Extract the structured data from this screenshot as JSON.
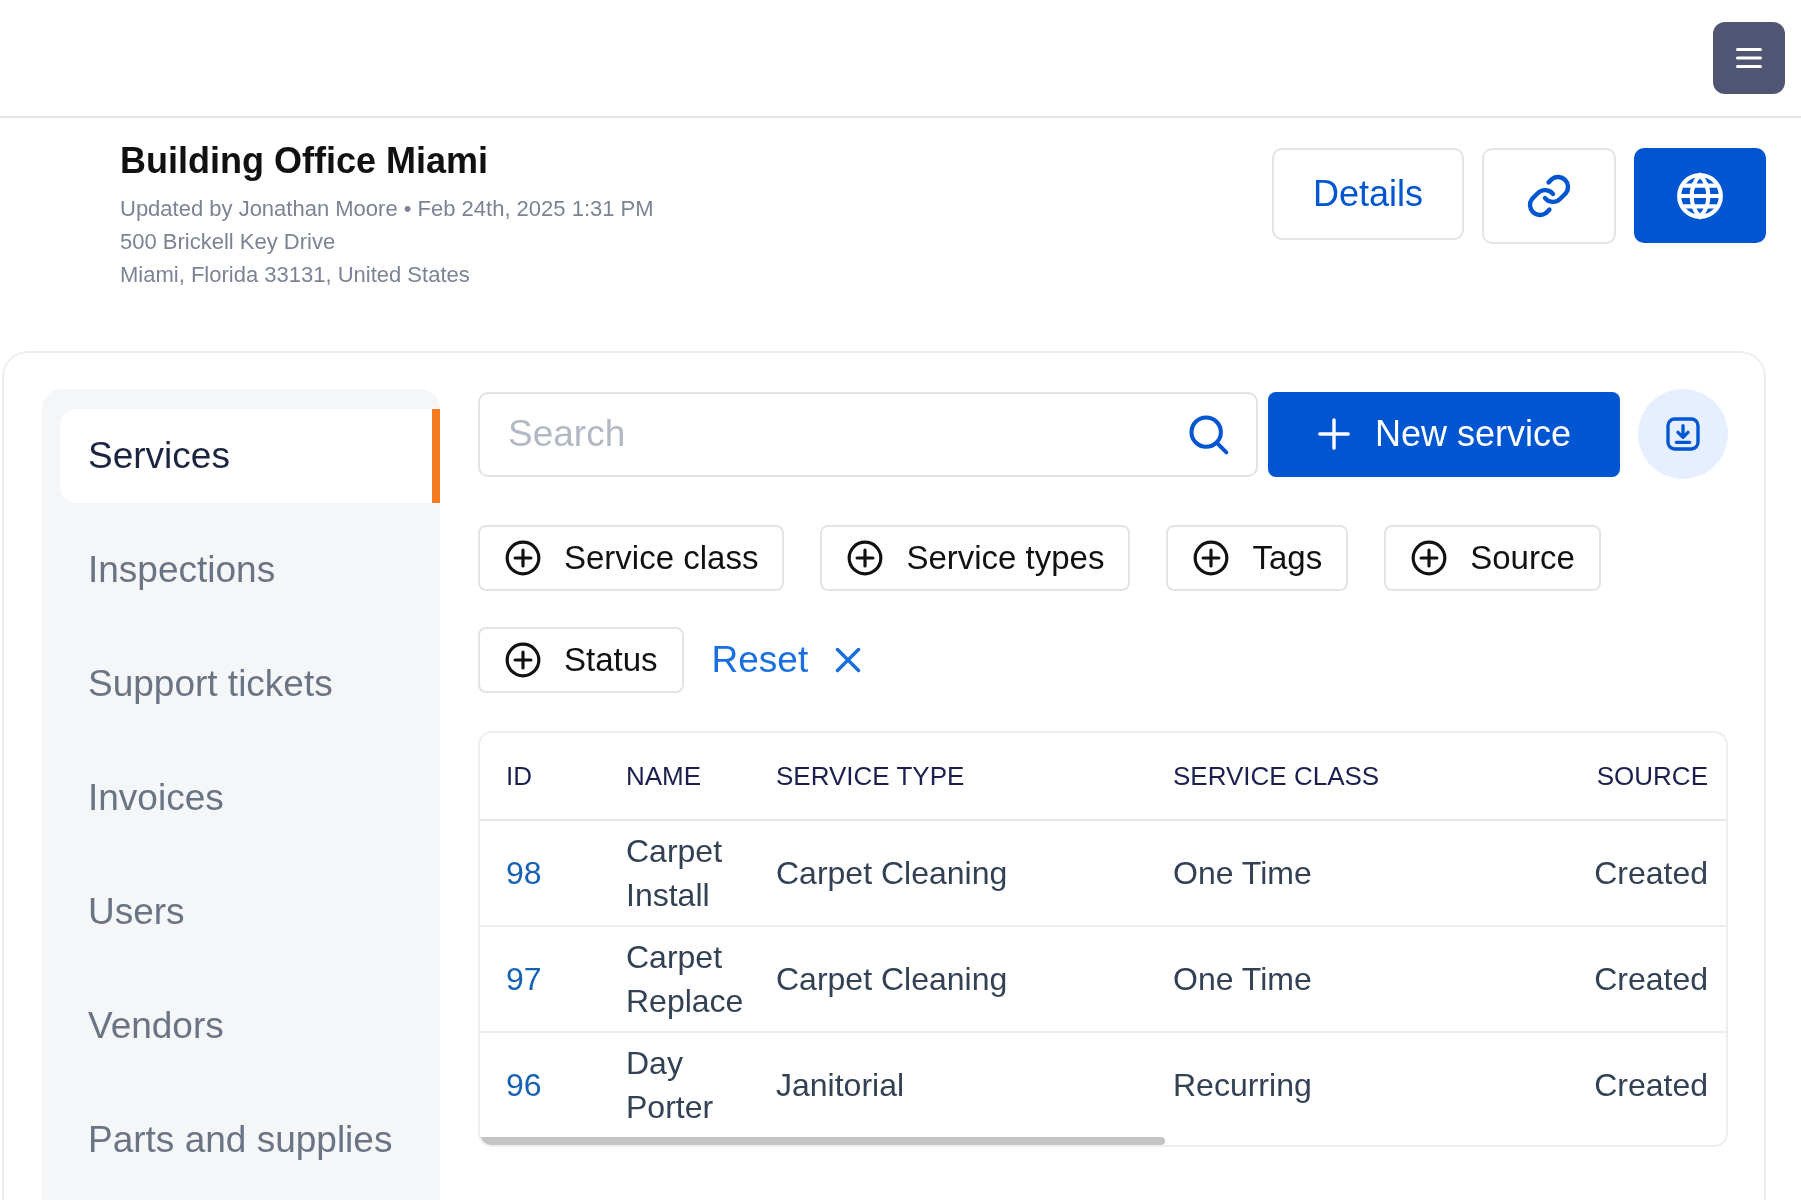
{
  "header": {
    "title": "Building Office Miami",
    "updated": "Updated by Jonathan Moore • Feb 24th, 2025 1:31 PM",
    "address_line_1": "500 Brickell Key Drive",
    "address_line_2": "Miami, Florida 33131, United States",
    "details_button": "Details"
  },
  "sidebar": {
    "items": [
      {
        "label": "Services",
        "selected": true
      },
      {
        "label": "Inspections",
        "selected": false
      },
      {
        "label": "Support tickets",
        "selected": false
      },
      {
        "label": "Invoices",
        "selected": false
      },
      {
        "label": "Users",
        "selected": false
      },
      {
        "label": "Vendors",
        "selected": false
      },
      {
        "label": "Parts and supplies",
        "selected": false
      }
    ]
  },
  "search": {
    "placeholder": "Search"
  },
  "new_service_button": "New service",
  "filters": [
    "Service class",
    "Service types",
    "Tags",
    "Source",
    "Status"
  ],
  "reset": "Reset",
  "table": {
    "columns": [
      "ID",
      "NAME",
      "SERVICE TYPE",
      "SERVICE CLASS",
      "SOURCE"
    ],
    "rows": [
      {
        "id": "98",
        "name": "Carpet Install",
        "service_type": "Carpet Cleaning",
        "service_class": "One Time",
        "source": "Created"
      },
      {
        "id": "97",
        "name": "Carpet Replace",
        "service_type": "Carpet Cleaning",
        "service_class": "One Time",
        "source": "Created"
      },
      {
        "id": "96",
        "name": "Day Porter",
        "service_type": "Janitorial",
        "service_class": "Recurring",
        "source": "Created"
      }
    ]
  }
}
